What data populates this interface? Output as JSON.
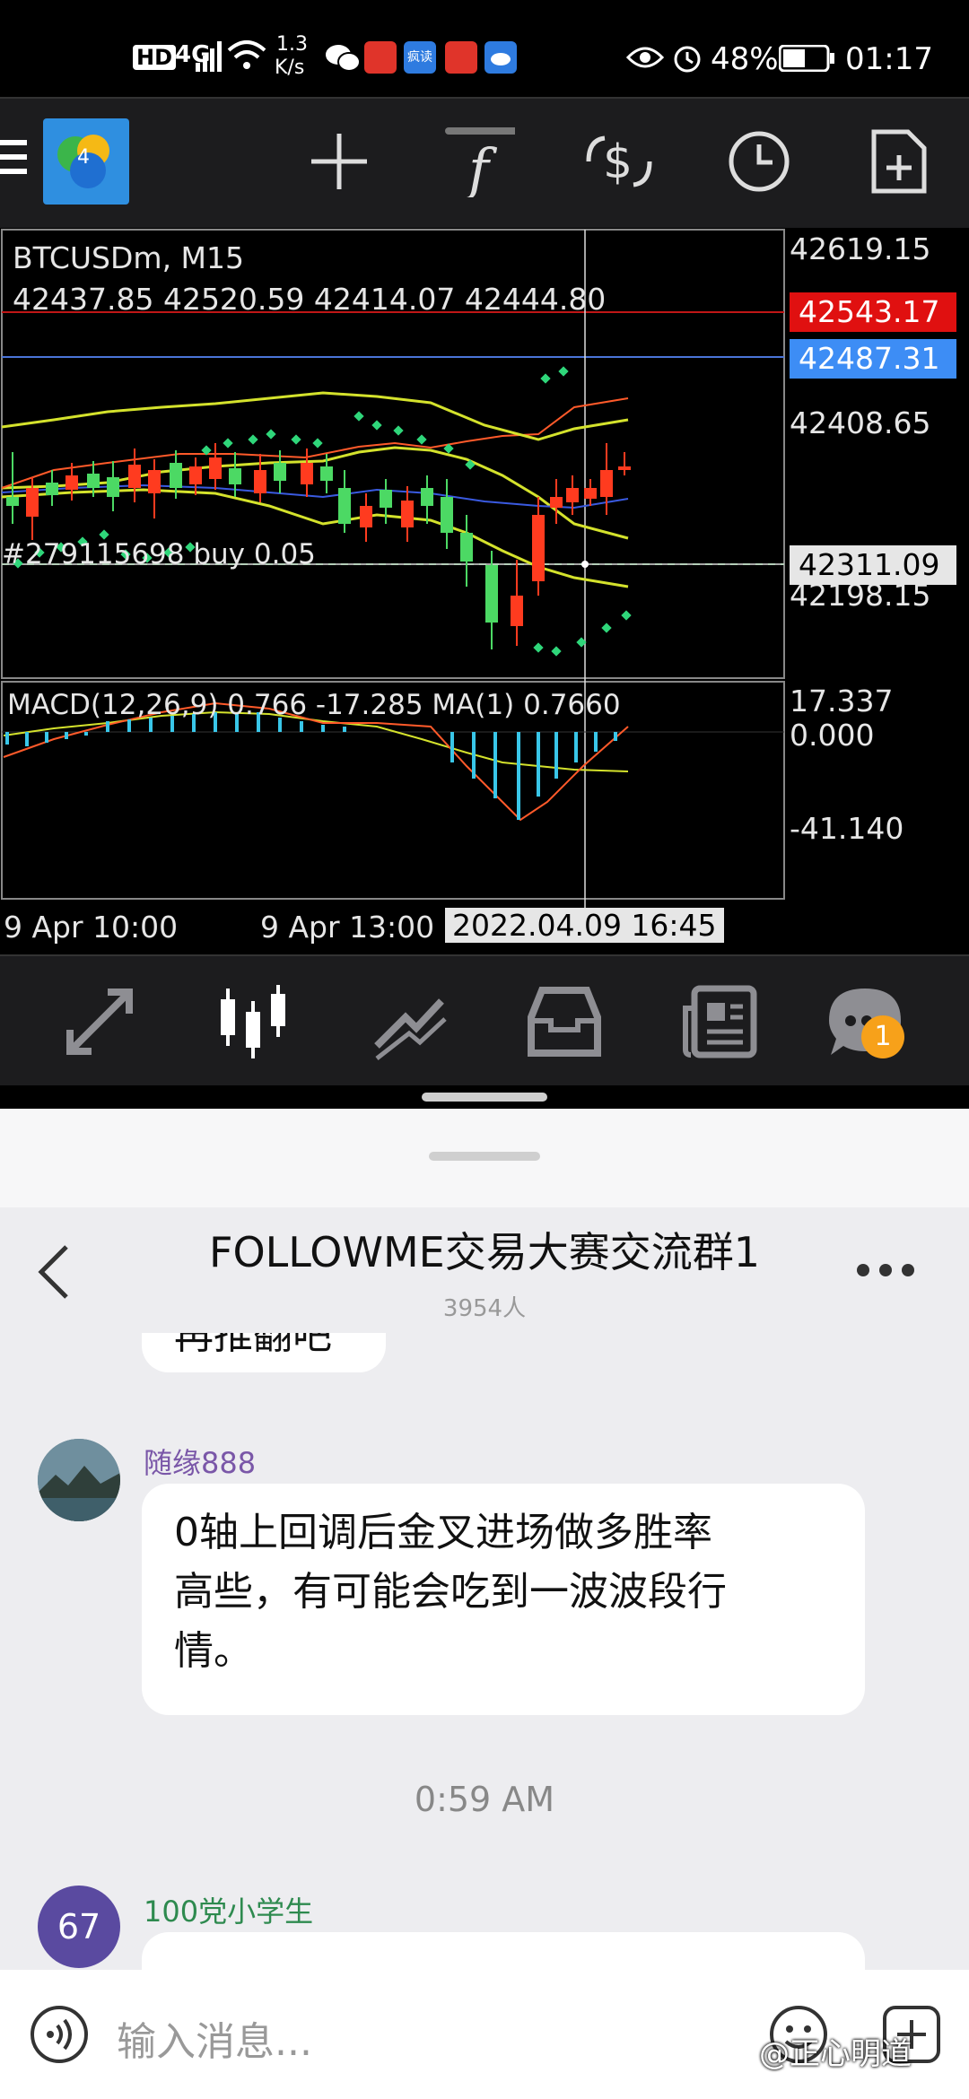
{
  "status_bar": {
    "net_type": "HD",
    "signal_badge": "4G",
    "speed_value": "1.3",
    "speed_unit": "K/s",
    "app_badge": "疯读",
    "battery": "48%",
    "time": "01:17"
  },
  "chart": {
    "symbol": "BTCUSDm, M15",
    "ohlc": "42437.85 42520.59 42414.07 42444.80",
    "order_label": "#279115698 buy 0.05",
    "price_labels": [
      "42619.15",
      "42408.65",
      "42198.15"
    ],
    "ask_tag": "42543.17",
    "bid_tag": "42487.31",
    "cursor_price": "42311.09",
    "macd_label": "MACD(12,26,9) 0.766 -17.285 MA(1) 0.7660",
    "macd_scale": [
      "17.337",
      "0.000",
      "-41.140"
    ],
    "time_labels": [
      "9 Apr 10:00",
      "9 Apr 13:00"
    ],
    "cursor_time": "2022.04.09 16:45"
  },
  "mt_nav": {
    "notification_count": "1"
  },
  "chat": {
    "group_title": "FOLLOWME交易大赛交流群1",
    "member_count": "3954人",
    "partial_text": "再推翻吧",
    "msg1_user": "随缘888",
    "msg1_lines": [
      "0轴上回调后金叉进场做多胜率",
      "高些，有可能会吃到一波波段行",
      "情。"
    ],
    "timestamp": "0:59 AM",
    "msg2_user": "100党小学生",
    "msg2_avatar": "67",
    "input_placeholder": "输入消息...",
    "watermark": "@正心明道"
  },
  "colors": {
    "bull": "#4cd964",
    "bear": "#ff3b1f",
    "ask": "#e01010",
    "bid": "#3d8df5",
    "macd_hist": "#39c6e8",
    "band": "#d4e22c",
    "sar": "#2fd67a",
    "username_purple": "#7a57a8",
    "username_green": "#2e8a4f",
    "badge_orange": "#f7a11a"
  }
}
